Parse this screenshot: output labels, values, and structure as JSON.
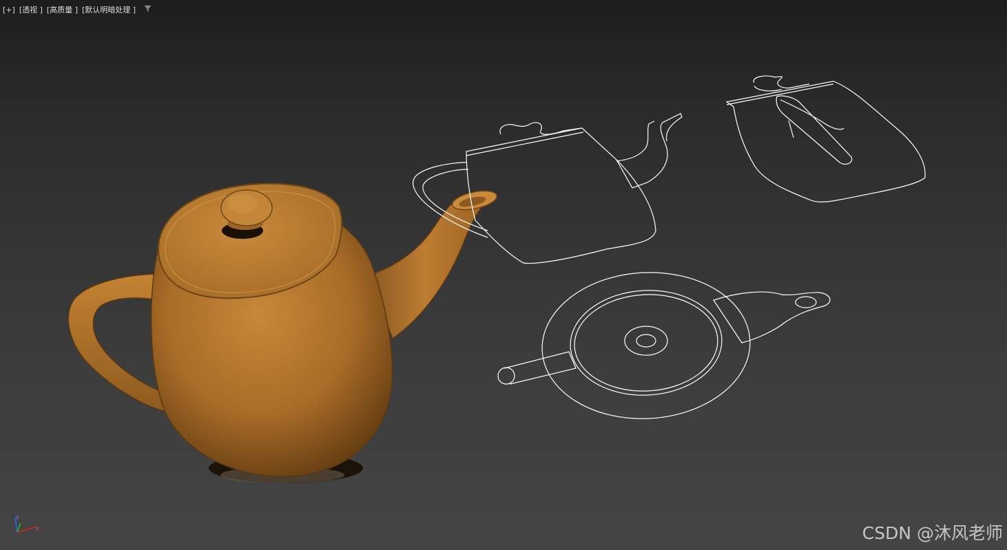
{
  "viewport": {
    "labels": {
      "plus": "[+]",
      "view": "[透视 ]",
      "quality": "[高质量 ]",
      "lighting": "[默认明暗处理 ]"
    },
    "filter_icon": "funnel-icon",
    "axis_labels": {
      "z": "z",
      "x": "x"
    }
  },
  "colors": {
    "background_top": "#1d1d1d",
    "background_bottom": "#444444",
    "teapot": "#b9782c",
    "wireframe": "#ffffff",
    "axis_x": "#e02020",
    "axis_y": "#20c020",
    "axis_z": "#3060ff"
  },
  "watermark": "CSDN @沐风老师"
}
